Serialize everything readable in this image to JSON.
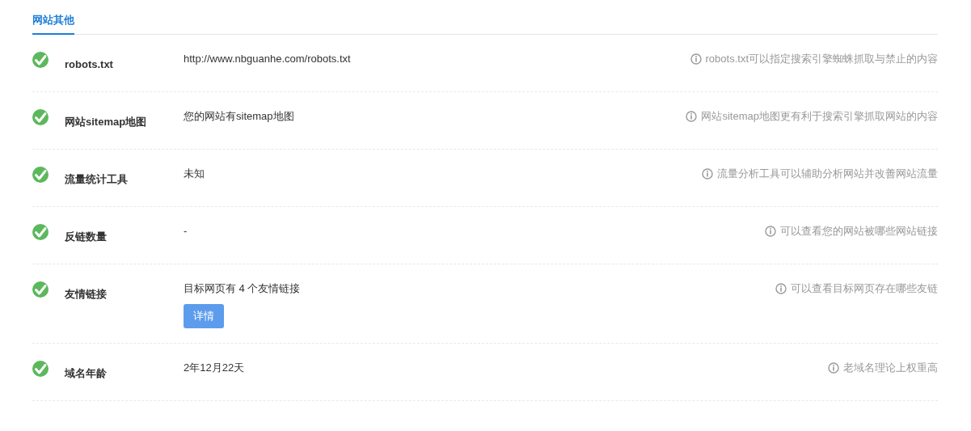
{
  "tabs": [
    {
      "label": "网站其他",
      "selected": true
    }
  ],
  "rows": [
    {
      "passed": true,
      "label": "robots.txt",
      "value": "http://www.nbguanhe.com/robots.txt",
      "hint": "robots.txt可以指定搜索引擎蜘蛛抓取与禁止的内容"
    },
    {
      "passed": true,
      "label": "网站sitemap地图",
      "value": "您的网站有sitemap地图",
      "hint": "网站sitemap地图更有利于搜索引擎抓取网站的内容"
    },
    {
      "passed": true,
      "label": "流量统计工具",
      "value": "未知",
      "hint": "流量分析工具可以辅助分析网站并改善网站流量"
    },
    {
      "passed": true,
      "label": "反链数量",
      "value": "-",
      "hint": "可以查看您的网站被哪些网站链接"
    },
    {
      "passed": true,
      "label": "友情链接",
      "value": "目标网页有 4 个友情链接",
      "button": "详情",
      "hint": "可以查看目标网页存在哪些友链"
    },
    {
      "passed": true,
      "label": "域名年龄",
      "value": "2年12月22天",
      "hint": "老域名理论上权重高"
    }
  ]
}
